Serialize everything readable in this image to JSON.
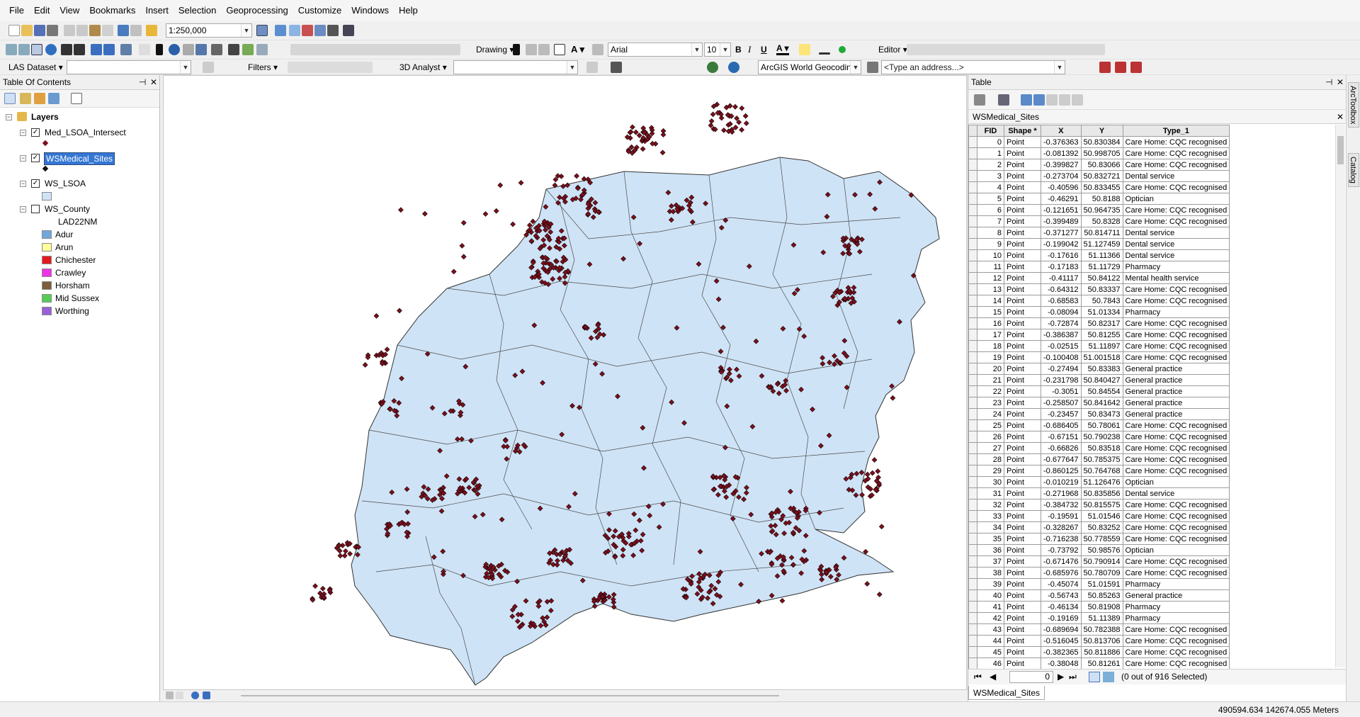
{
  "menu": [
    "File",
    "Edit",
    "View",
    "Bookmarks",
    "Insert",
    "Selection",
    "Geoprocessing",
    "Customize",
    "Windows",
    "Help"
  ],
  "toolbar": {
    "scale": "1:250,000",
    "drawing_label": "Drawing",
    "font_name": "Arial",
    "font_size": "10",
    "bold": "B",
    "italic": "I",
    "underline": "U",
    "editor_label": "Editor",
    "las_dataset": "LAS Dataset",
    "filters": "Filters",
    "analyst_3d": "3D Analyst",
    "geocoder": "ArcGIS World Geocoding",
    "address_placeholder": "<Type an address...>"
  },
  "toc": {
    "title": "Table Of Contents",
    "root": "Layers",
    "layers": [
      {
        "name": "Med_LSOA_Intersect",
        "checked": true
      },
      {
        "name": "WSMedical_Sites",
        "checked": true,
        "selected": true
      },
      {
        "name": "WS_LSOA",
        "checked": true
      },
      {
        "name": "WS_County",
        "checked": false
      }
    ],
    "field": "LAD22NM",
    "legend": [
      {
        "label": "Adur",
        "color": "#6fa8dc"
      },
      {
        "label": "Arun",
        "color": "#ffff99"
      },
      {
        "label": "Chichester",
        "color": "#e31a1c"
      },
      {
        "label": "Crawley",
        "color": "#f032e6"
      },
      {
        "label": "Horsham",
        "color": "#7b5e3a"
      },
      {
        "label": "Mid Sussex",
        "color": "#55cc55"
      },
      {
        "label": "Worthing",
        "color": "#9a5fd6"
      }
    ],
    "colors": {
      "polygon_fill": "#cfe3f6",
      "point": "#7a0f1c"
    }
  },
  "table": {
    "title": "Table",
    "layer": "WSMedical_Sites",
    "columns": [
      "FID",
      "Shape *",
      "X",
      "Y",
      "Type_1"
    ],
    "rows": [
      [
        "0",
        "Point",
        "-0.376363",
        "50.830384",
        "Care Home: CQC recognised"
      ],
      [
        "1",
        "Point",
        "-0.081392",
        "50.998705",
        "Care Home: CQC recognised"
      ],
      [
        "2",
        "Point",
        "-0.399827",
        "50.83066",
        "Care Home: CQC recognised"
      ],
      [
        "3",
        "Point",
        "-0.273704",
        "50.832721",
        "Dental service"
      ],
      [
        "4",
        "Point",
        "-0.40596",
        "50.833455",
        "Care Home: CQC recognised"
      ],
      [
        "5",
        "Point",
        "-0.46291",
        "50.8188",
        "Optician"
      ],
      [
        "6",
        "Point",
        "-0.121651",
        "50.964735",
        "Care Home: CQC recognised"
      ],
      [
        "7",
        "Point",
        "-0.399489",
        "50.8328",
        "Care Home: CQC recognised"
      ],
      [
        "8",
        "Point",
        "-0.371277",
        "50.814711",
        "Dental service"
      ],
      [
        "9",
        "Point",
        "-0.199042",
        "51.127459",
        "Dental service"
      ],
      [
        "10",
        "Point",
        "-0.17616",
        "51.11366",
        "Dental service"
      ],
      [
        "11",
        "Point",
        "-0.17183",
        "51.11729",
        "Pharmacy"
      ],
      [
        "12",
        "Point",
        "-0.41117",
        "50.84122",
        "Mental health service"
      ],
      [
        "13",
        "Point",
        "-0.64312",
        "50.83337",
        "Care Home: CQC recognised"
      ],
      [
        "14",
        "Point",
        "-0.68583",
        "50.7843",
        "Care Home: CQC recognised"
      ],
      [
        "15",
        "Point",
        "-0.08094",
        "51.01334",
        "Pharmacy"
      ],
      [
        "16",
        "Point",
        "-0.72874",
        "50.82317",
        "Care Home: CQC recognised"
      ],
      [
        "17",
        "Point",
        "-0.386387",
        "50.81255",
        "Care Home: CQC recognised"
      ],
      [
        "18",
        "Point",
        "-0.02515",
        "51.11897",
        "Care Home: CQC recognised"
      ],
      [
        "19",
        "Point",
        "-0.100408",
        "51.001518",
        "Care Home: CQC recognised"
      ],
      [
        "20",
        "Point",
        "-0.27494",
        "50.83383",
        "General practice"
      ],
      [
        "21",
        "Point",
        "-0.231798",
        "50.840427",
        "General practice"
      ],
      [
        "22",
        "Point",
        "-0.3051",
        "50.84554",
        "General practice"
      ],
      [
        "23",
        "Point",
        "-0.258507",
        "50.841642",
        "General practice"
      ],
      [
        "24",
        "Point",
        "-0.23457",
        "50.83473",
        "General practice"
      ],
      [
        "25",
        "Point",
        "-0.686405",
        "50.78061",
        "Care Home: CQC recognised"
      ],
      [
        "26",
        "Point",
        "-0.67151",
        "50.790238",
        "Care Home: CQC recognised"
      ],
      [
        "27",
        "Point",
        "-0.66826",
        "50.83518",
        "Care Home: CQC recognised"
      ],
      [
        "28",
        "Point",
        "-0.677647",
        "50.785375",
        "Care Home: CQC recognised"
      ],
      [
        "29",
        "Point",
        "-0.860125",
        "50.764768",
        "Care Home: CQC recognised"
      ],
      [
        "30",
        "Point",
        "-0.010219",
        "51.126476",
        "Optician"
      ],
      [
        "31",
        "Point",
        "-0.271968",
        "50.835856",
        "Dental service"
      ],
      [
        "32",
        "Point",
        "-0.384732",
        "50.815575",
        "Care Home: CQC recognised"
      ],
      [
        "33",
        "Point",
        "-0.19591",
        "51.01546",
        "Care Home: CQC recognised"
      ],
      [
        "34",
        "Point",
        "-0.328267",
        "50.83252",
        "Care Home: CQC recognised"
      ],
      [
        "35",
        "Point",
        "-0.716238",
        "50.778559",
        "Care Home: CQC recognised"
      ],
      [
        "36",
        "Point",
        "-0.73792",
        "50.98576",
        "Optician"
      ],
      [
        "37",
        "Point",
        "-0.671476",
        "50.790914",
        "Care Home: CQC recognised"
      ],
      [
        "38",
        "Point",
        "-0.685976",
        "50.780709",
        "Care Home: CQC recognised"
      ],
      [
        "39",
        "Point",
        "-0.45074",
        "51.01591",
        "Pharmacy"
      ],
      [
        "40",
        "Point",
        "-0.56743",
        "50.85263",
        "General practice"
      ],
      [
        "41",
        "Point",
        "-0.46134",
        "50.81908",
        "Pharmacy"
      ],
      [
        "42",
        "Point",
        "-0.19169",
        "51.11389",
        "Pharmacy"
      ],
      [
        "43",
        "Point",
        "-0.689694",
        "50.782388",
        "Care Home: CQC recognised"
      ],
      [
        "44",
        "Point",
        "-0.516045",
        "50.813706",
        "Care Home: CQC recognised"
      ],
      [
        "45",
        "Point",
        "-0.382365",
        "50.811886",
        "Care Home: CQC recognised"
      ],
      [
        "46",
        "Point",
        "-0.38048",
        "50.81261",
        "Care Home: CQC recognised"
      ]
    ],
    "nav_record": "0",
    "selection_status": "(0 out of 916 Selected)",
    "tab_label": "WSMedical_Sites"
  },
  "dock": {
    "arctoolbox": "ArcToolbox",
    "catalog": "Catalog"
  },
  "status": {
    "coords": "490594.634  142674.055 Meters"
  }
}
